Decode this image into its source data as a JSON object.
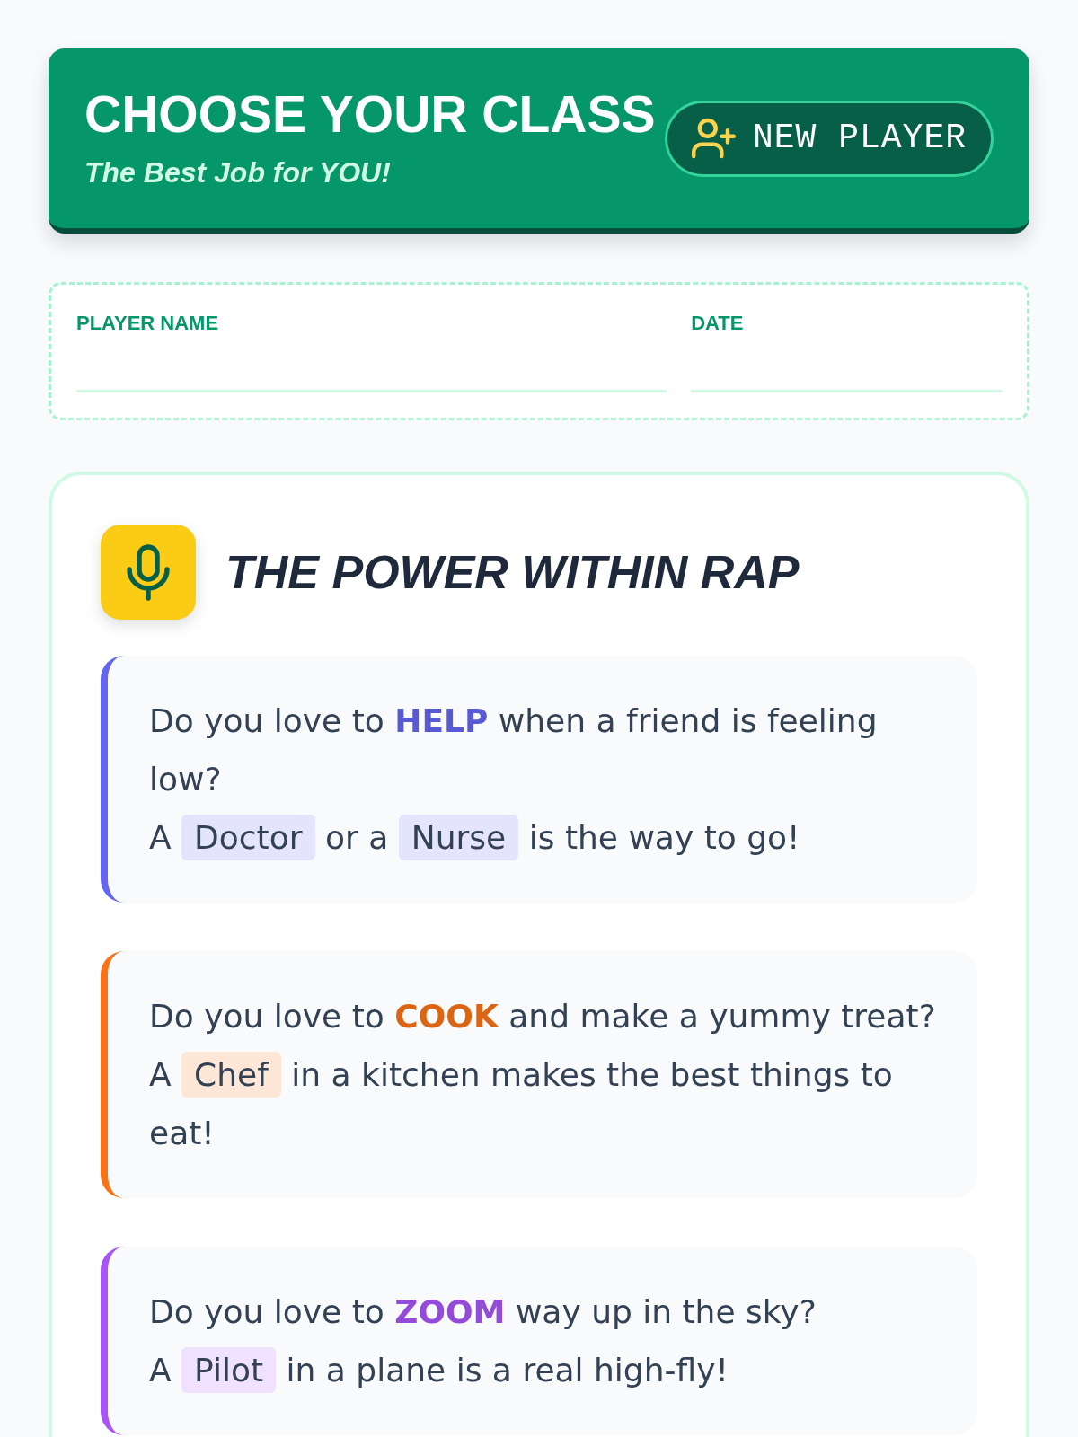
{
  "header": {
    "title": "CHOOSE YOUR CLASS",
    "subtitle": "The Best Job for YOU!",
    "button": {
      "label": "NEW PLAYER"
    }
  },
  "player_form": {
    "fields": [
      {
        "label": "PLAYER NAME"
      },
      {
        "label": "DATE"
      }
    ]
  },
  "rap": {
    "title": "THE POWER WITHIN RAP",
    "verses": [
      {
        "color": "#6366f1",
        "lines": [
          [
            {
              "kind": "text",
              "text": "Do you love to "
            },
            {
              "kind": "keyword",
              "text": "HELP"
            },
            {
              "kind": "text",
              "text": " when a friend is feeling low?"
            }
          ],
          [
            {
              "kind": "text",
              "text": "A "
            },
            {
              "kind": "job",
              "text": "Doctor"
            },
            {
              "kind": "text",
              "text": " or a "
            },
            {
              "kind": "job",
              "text": "Nurse"
            },
            {
              "kind": "text",
              "text": " is the way to go!"
            }
          ]
        ]
      },
      {
        "color": "#f97316",
        "lines": [
          [
            {
              "kind": "text",
              "text": "Do you love to "
            },
            {
              "kind": "keyword",
              "text": "COOK"
            },
            {
              "kind": "text",
              "text": " and make a yummy treat?"
            }
          ],
          [
            {
              "kind": "text",
              "text": "A "
            },
            {
              "kind": "job",
              "text": "Chef"
            },
            {
              "kind": "text",
              "text": " in a kitchen makes the best things to eat!"
            }
          ]
        ]
      },
      {
        "color": "#a855f7",
        "lines": [
          [
            {
              "kind": "text",
              "text": "Do you love to "
            },
            {
              "kind": "keyword",
              "text": "ZOOM"
            },
            {
              "kind": "text",
              "text": " way up in the sky?"
            }
          ],
          [
            {
              "kind": "text",
              "text": "A "
            },
            {
              "kind": "job",
              "text": "Pilot"
            },
            {
              "kind": "text",
              "text": " in a plane is a real high-fly!"
            }
          ]
        ]
      }
    ]
  }
}
